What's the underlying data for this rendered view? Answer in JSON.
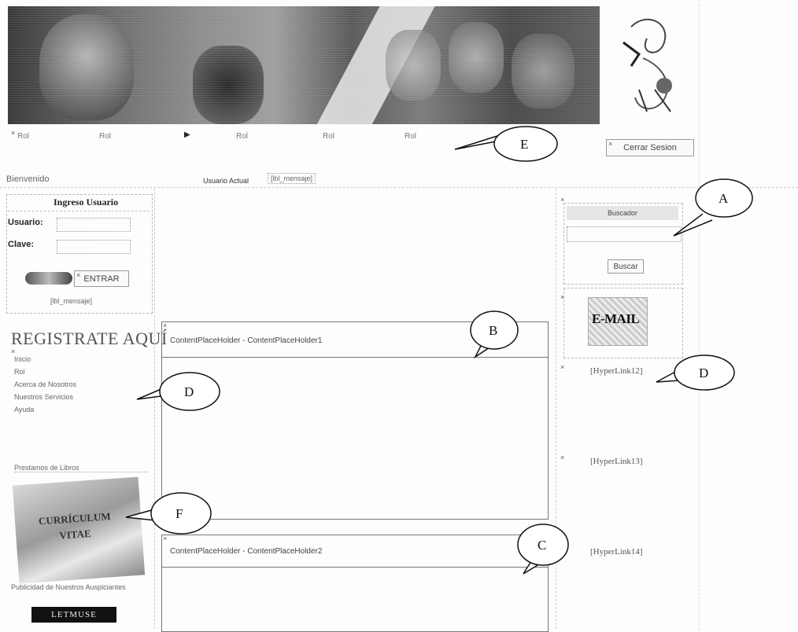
{
  "header": {
    "menu": [
      "Rol",
      "Rol",
      "Rol",
      "Rol",
      "Rol"
    ],
    "close_session": "Cerrar Sesion",
    "sub_left": "Bienvenido",
    "sub_mid1": "Usuario Actual",
    "sub_mid2": "[lbl_mensaje]"
  },
  "login": {
    "title": "Ingreso Usuario",
    "user_label": "Usuario:",
    "password_label": "Clave:",
    "enter_button": "ENTRAR",
    "message": "[lbl_mensaje]"
  },
  "left": {
    "register": "REGISTRATE AQUÍ",
    "links": [
      "Inicio",
      "Rol",
      "Acerca de Nosotros",
      "Nuestros Servicios",
      "Ayuda"
    ],
    "section_label": "Prestamos de Libros",
    "card_text": [
      "CURRÍCULUM",
      "VITAE"
    ],
    "bottom_caption": "Publicidad de Nuestros Auspiciantes",
    "bottom_logo": "LETMUSE"
  },
  "main": {
    "placeholder1": "ContentPlaceHolder - ContentPlaceHolder1",
    "placeholder2": "ContentPlaceHolder - ContentPlaceHolder2"
  },
  "right": {
    "search_label": "Buscador",
    "search_button": "Buscar",
    "email_banner": "E-MAIL",
    "hyperlinks": [
      "[HyperLink12]",
      "[HyperLink13]",
      "[HyperLink14]"
    ]
  },
  "callouts": {
    "a": "A",
    "b": "B",
    "c": "C",
    "d1": "D",
    "d2": "D",
    "e": "E",
    "f": "F"
  },
  "icons": {
    "close": "close-x-icon"
  }
}
